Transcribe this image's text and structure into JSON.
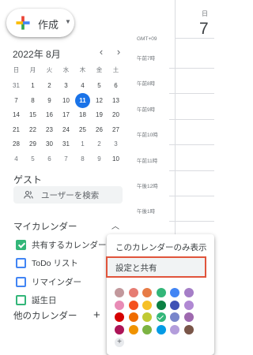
{
  "create": {
    "label": "作成"
  },
  "mini_calendar": {
    "month_label": "2022年 8月",
    "weekdays": [
      "日",
      "月",
      "火",
      "水",
      "木",
      "金",
      "土"
    ],
    "weeks": [
      [
        "31",
        "1",
        "2",
        "3",
        "4",
        "5",
        "6"
      ],
      [
        "7",
        "8",
        "9",
        "10",
        "11",
        "12",
        "13"
      ],
      [
        "14",
        "15",
        "16",
        "17",
        "18",
        "19",
        "20"
      ],
      [
        "21",
        "22",
        "23",
        "24",
        "25",
        "26",
        "27"
      ],
      [
        "28",
        "29",
        "30",
        "31",
        "1",
        "2",
        "3"
      ],
      [
        "4",
        "5",
        "6",
        "7",
        "8",
        "9",
        "10"
      ]
    ],
    "today": "11"
  },
  "guests": {
    "title": "ゲスト",
    "search_placeholder": "ユーザーを検索"
  },
  "my_calendars": {
    "title": "マイカレンダー",
    "items": [
      {
        "name": "共有するカレンダー",
        "color": "#33b679",
        "checked": true
      },
      {
        "name": "ToDo リスト",
        "color": "#4285f4",
        "checked": false
      },
      {
        "name": "リマインダー",
        "color": "#4285f4",
        "checked": false
      },
      {
        "name": "誕生日",
        "color": "#33b679",
        "checked": false
      }
    ]
  },
  "other_calendars": {
    "title": "他のカレンダー"
  },
  "day_view": {
    "weekday": "日",
    "date": "7",
    "timezone": "GMT+09",
    "hours": [
      "午前7時",
      "午前8時",
      "午前9時",
      "午前10時",
      "午前11時",
      "午後12時",
      "午後1時"
    ]
  },
  "context_menu": {
    "display_only": "このカレンダーのみ表示",
    "settings_share": "設定と共有",
    "highlight_color": "#e0543b",
    "colors": [
      [
        "#c2989c",
        "#e67c73",
        "#e77b46",
        "#33b679",
        "#4285f4",
        "#a57ec7"
      ],
      [
        "#e88bb5",
        "#f4511e",
        "#f6c026",
        "#0b8043",
        "#3f51b5",
        "#b088d3"
      ],
      [
        "#d50000",
        "#ef6c00",
        "#c0ca33",
        "#33b679",
        "#7986cb",
        "#9e69af"
      ],
      [
        "#ad1457",
        "#f09300",
        "#7cb342",
        "#039be5",
        "#b39ddb",
        "#795548"
      ]
    ]
  }
}
